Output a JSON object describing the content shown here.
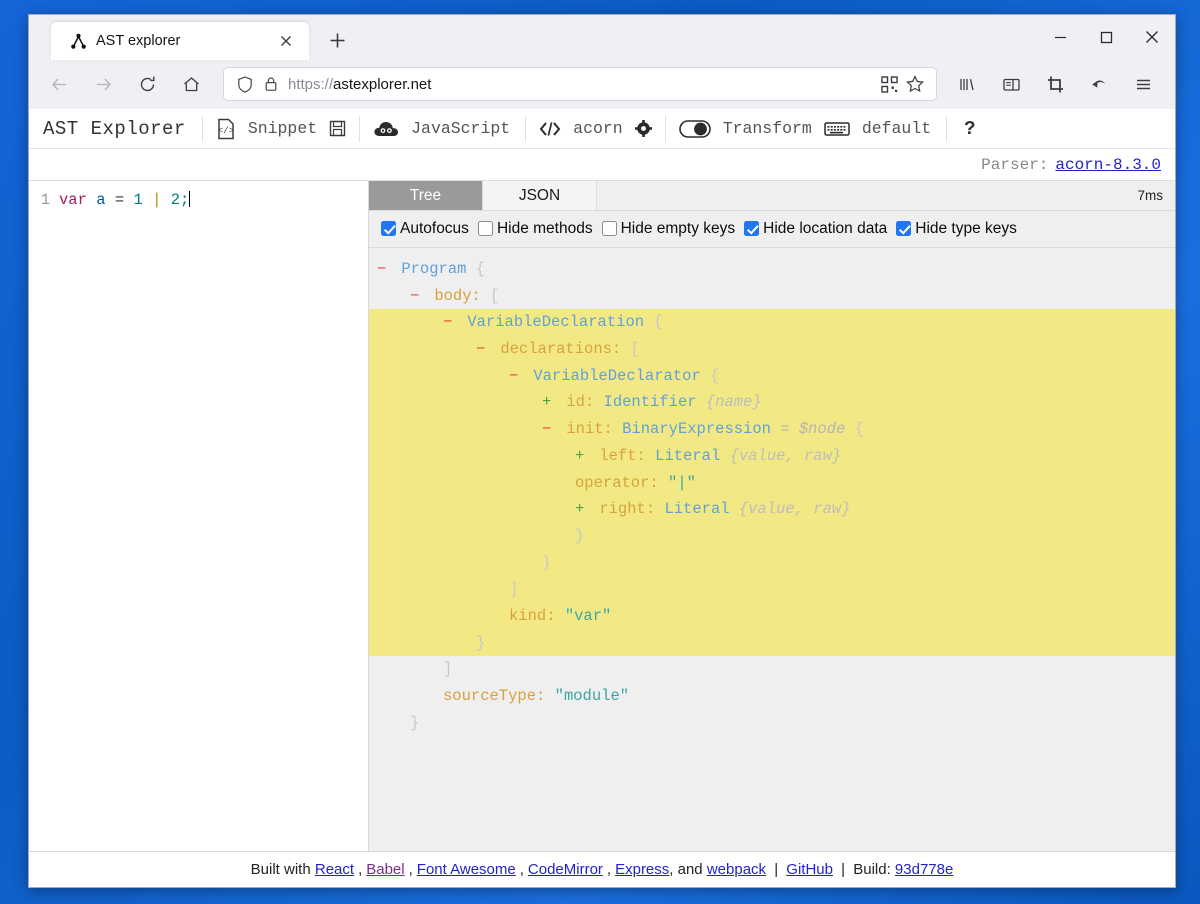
{
  "browser": {
    "tab": {
      "title": "AST explorer",
      "favicon_icon": "ast-tree-icon",
      "close_icon": "close-icon"
    },
    "newtab_icon": "plus-icon",
    "window_controls": {
      "minimize": "minimize-icon",
      "maximize": "maximize-icon",
      "close": "close-icon"
    },
    "nav": {
      "back_icon": "arrow-left-icon",
      "forward_icon": "arrow-right-icon",
      "reload_icon": "reload-icon",
      "home_icon": "home-icon"
    },
    "urlbar": {
      "shield_icon": "shield-icon",
      "lock_icon": "lock-icon",
      "scheme": "https://",
      "host": "astexplorer.net",
      "qr_icon": "qr-code-icon",
      "bookmark_icon": "star-icon"
    },
    "toolbar_icons": {
      "library": "library-icon",
      "sidebar": "sidebar-icon",
      "screenshot": "crop-icon",
      "undo": "undo-arrow-icon",
      "menu": "hamburger-menu-icon"
    }
  },
  "ast_toolbar": {
    "brand": "AST Explorer",
    "snippet_icon": "code-file-icon",
    "snippet_label": "Snippet",
    "save_icon": "floppy-save-icon",
    "language_icon": "javascript-cloud-icon",
    "language_label": "JavaScript",
    "parser_icon": "code-brackets-icon",
    "parser_label": "acorn",
    "settings_icon": "gear-icon",
    "toggle_icon": "toggle-switch-icon",
    "transform_label": "Transform",
    "keymap_icon": "keyboard-icon",
    "keymap_label": "default",
    "help_label": "?"
  },
  "parser_info": {
    "label": "Parser:",
    "version": "acorn-8.3.0"
  },
  "editor": {
    "line_number": "1",
    "tokens": {
      "kw": "var",
      "varname": "a",
      "eq": "=",
      "num1": "1",
      "pipe": "|",
      "num2": "2;"
    }
  },
  "tree_panel": {
    "tabs": [
      {
        "label": "Tree",
        "active": true
      },
      {
        "label": "JSON",
        "active": false
      }
    ],
    "timing": "7ms",
    "options": [
      {
        "label": "Autofocus",
        "checked": true
      },
      {
        "label": "Hide methods",
        "checked": false
      },
      {
        "label": "Hide empty keys",
        "checked": false
      },
      {
        "label": "Hide location data",
        "checked": true
      },
      {
        "label": "Hide type keys",
        "checked": true
      }
    ],
    "rows": [
      {
        "indent": 0,
        "toggle": "minus",
        "type": "Program",
        "open": "{",
        "highlight": false
      },
      {
        "indent": 1,
        "toggle": "minus",
        "key": "body:",
        "open": "[",
        "highlight": false
      },
      {
        "indent": 2,
        "toggle": "minus",
        "type": "VariableDeclaration",
        "open": "{",
        "highlight": true
      },
      {
        "indent": 3,
        "toggle": "minus",
        "key": "declarations:",
        "open": "[",
        "highlight": true
      },
      {
        "indent": 4,
        "toggle": "minus",
        "type": "VariableDeclarator",
        "open": "{",
        "highlight": true
      },
      {
        "indent": 5,
        "toggle": "plus",
        "key": "id:",
        "type": "Identifier",
        "hint": "{name}",
        "highlight": true
      },
      {
        "indent": 5,
        "toggle": "minus",
        "key": "init:",
        "type": "BinaryExpression",
        "node_ref": "= $node",
        "open": "{",
        "highlight": true
      },
      {
        "indent": 6,
        "toggle": "plus",
        "key": "left:",
        "type": "Literal",
        "hint": "{value, raw}",
        "highlight": true
      },
      {
        "indent": 6,
        "toggle": "none",
        "key": "operator:",
        "value": "\"|\"",
        "highlight": true
      },
      {
        "indent": 6,
        "toggle": "plus",
        "key": "right:",
        "type": "Literal",
        "hint": "{value, raw}",
        "highlight": true
      },
      {
        "indent": 6,
        "close": "}",
        "highlight": true
      },
      {
        "indent": 5,
        "close": "}",
        "highlight": true
      },
      {
        "indent": 4,
        "close": "]",
        "highlight": true
      },
      {
        "indent": 4,
        "key": "kind:",
        "value": "\"var\"",
        "highlight": true
      },
      {
        "indent": 3,
        "close": "}",
        "highlight": true
      },
      {
        "indent": 2,
        "close": "]",
        "highlight": false
      },
      {
        "indent": 2,
        "key": "sourceType:",
        "value": "\"module\"",
        "highlight": false
      },
      {
        "indent": 1,
        "close": "}",
        "highlight": false
      }
    ]
  },
  "footer": {
    "built_with": "Built with",
    "links": [
      "React",
      "Babel",
      "Font Awesome",
      "CodeMirror",
      "Express"
    ],
    "and": ", and",
    "webpack": "webpack",
    "github": "GitHub",
    "build_label": "Build:",
    "build_hash": "93d778e"
  }
}
